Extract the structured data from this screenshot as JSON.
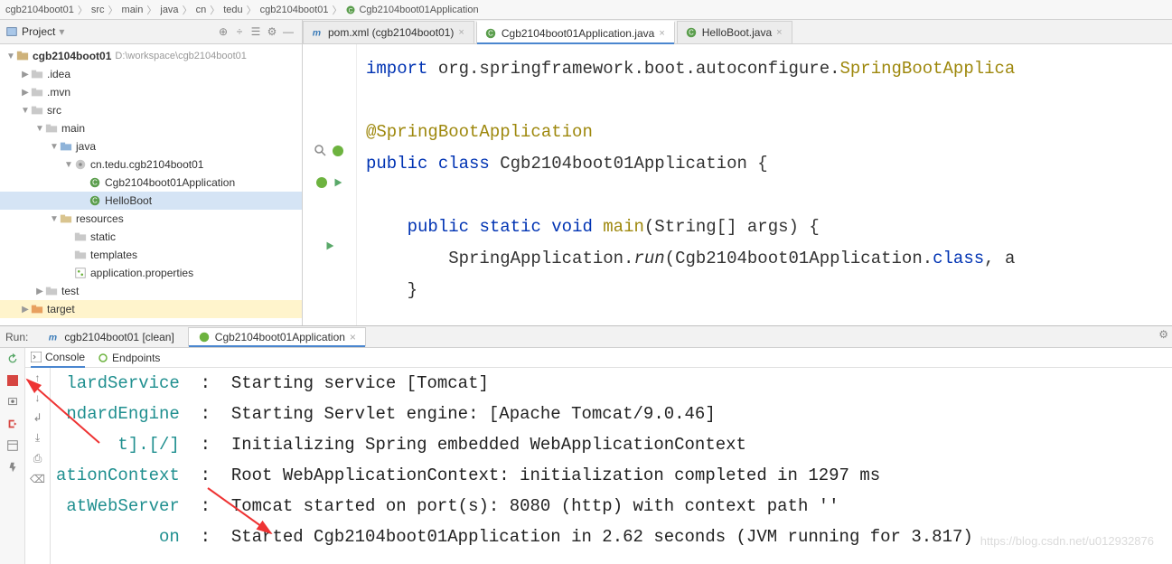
{
  "breadcrumb": [
    "cgb2104boot01",
    "src",
    "main",
    "java",
    "cn",
    "tedu",
    "cgb2104boot01",
    "Cgb2104boot01Application"
  ],
  "project_pane": {
    "title": "Project",
    "root": "cgb2104boot01",
    "root_path": "D:\\workspace\\cgb2104boot01",
    "items": [
      {
        "depth": 1,
        "arrow": "▶",
        "icon": "folder",
        "label": ".idea"
      },
      {
        "depth": 1,
        "arrow": "▶",
        "icon": "folder",
        "label": ".mvn"
      },
      {
        "depth": 1,
        "arrow": "▼",
        "icon": "folder",
        "label": "src"
      },
      {
        "depth": 2,
        "arrow": "▼",
        "icon": "folder",
        "label": "main"
      },
      {
        "depth": 3,
        "arrow": "▼",
        "icon": "folder-src",
        "label": "java"
      },
      {
        "depth": 4,
        "arrow": "▼",
        "icon": "package",
        "label": "cn.tedu.cgb2104boot01"
      },
      {
        "depth": 5,
        "arrow": "",
        "icon": "class",
        "label": "Cgb2104boot01Application"
      },
      {
        "depth": 5,
        "arrow": "",
        "icon": "class",
        "label": "HelloBoot",
        "selected": true
      },
      {
        "depth": 3,
        "arrow": "▼",
        "icon": "folder-res",
        "label": "resources"
      },
      {
        "depth": 4,
        "arrow": "",
        "icon": "folder",
        "label": "static"
      },
      {
        "depth": 4,
        "arrow": "",
        "icon": "folder",
        "label": "templates"
      },
      {
        "depth": 4,
        "arrow": "",
        "icon": "props",
        "label": "application.properties"
      },
      {
        "depth": 2,
        "arrow": "▶",
        "icon": "folder",
        "label": "test"
      },
      {
        "depth": 1,
        "arrow": "▶",
        "icon": "folder-target",
        "label": "target"
      }
    ]
  },
  "editor_tabs": [
    {
      "icon": "maven",
      "label": "pom.xml (cgb2104boot01)",
      "active": false
    },
    {
      "icon": "class",
      "label": "Cgb2104boot01Application.java",
      "active": true
    },
    {
      "icon": "class",
      "label": "HelloBoot.java",
      "active": false
    }
  ],
  "code": {
    "l1a": "import",
    "l1b": " org.springframework.boot.autoconfigure.",
    "l1c": "SpringBootApplica",
    "l3": "@SpringBootApplication",
    "l4a": "public",
    "l4b": "class",
    "l4c": " Cgb2104boot01Application {",
    "l6a": "public",
    "l6b": "static",
    "l6c": "void",
    "l6d": "main",
    "l6e": "(String[] args) {",
    "l7a": "        SpringApplication.",
    "l7b": "run",
    "l7c": "(Cgb2104boot01Application.",
    "l7d": "class",
    "l7e": ", a",
    "l8": "    }"
  },
  "run": {
    "label": "Run:",
    "tabs": [
      {
        "icon": "maven",
        "label": "cgb2104boot01 [clean]",
        "active": false
      },
      {
        "icon": "spring",
        "label": "Cgb2104boot01Application",
        "active": true
      }
    ],
    "console_tab": "Console",
    "endpoints_tab": "Endpoints",
    "lines": [
      {
        "src": "lardService",
        "msg": "Starting service [Tomcat]"
      },
      {
        "src": "ndardEngine",
        "msg": "Starting Servlet engine: [Apache Tomcat/9.0.46]"
      },
      {
        "src": "t].[/]",
        "msg": "Initializing Spring embedded WebApplicationContext"
      },
      {
        "src": "ationContext",
        "msg": "Root WebApplicationContext: initialization completed in 1297 ms"
      },
      {
        "src": "atWebServer",
        "msg": "Tomcat started on port(s): 8080 (http) with context path ''"
      },
      {
        "src": "on",
        "msg": "Started Cgb2104boot01Application in 2.62 seconds (JVM running for 3.817)"
      }
    ]
  },
  "watermark": "https://blog.csdn.net/u012932876"
}
